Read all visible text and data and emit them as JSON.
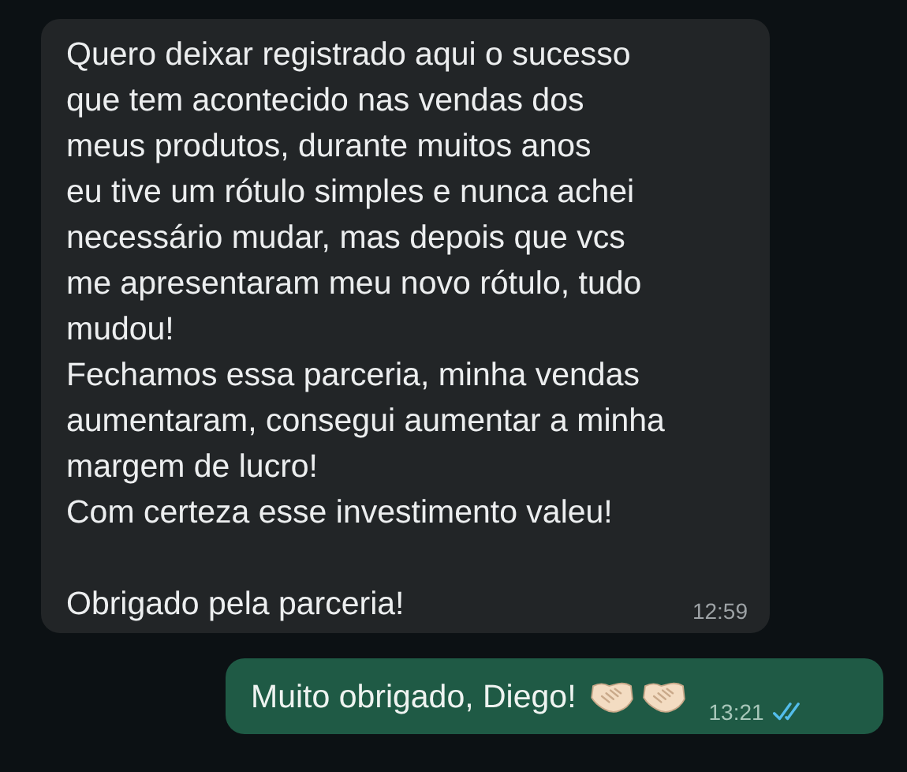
{
  "messages": [
    {
      "kind": "incoming",
      "text": "Quero deixar registrado aqui o sucesso\nque tem acontecido nas vendas dos\nmeus produtos, durante muitos anos\neu tive um rótulo simples e nunca achei\nnecessário mudar, mas depois que vcs\nme apresentaram meu novo rótulo, tudo\nmudou!\nFechamos essa parceria, minha vendas\naumentaram, consegui aumentar a minha\nmargem de lucro!\nCom certeza esse investimento valeu!\n\nObrigado pela parceria!",
      "time": "12:59"
    },
    {
      "kind": "outgoing",
      "text": "Muito obrigado, Diego!",
      "time": "13:21",
      "read": true
    }
  ]
}
